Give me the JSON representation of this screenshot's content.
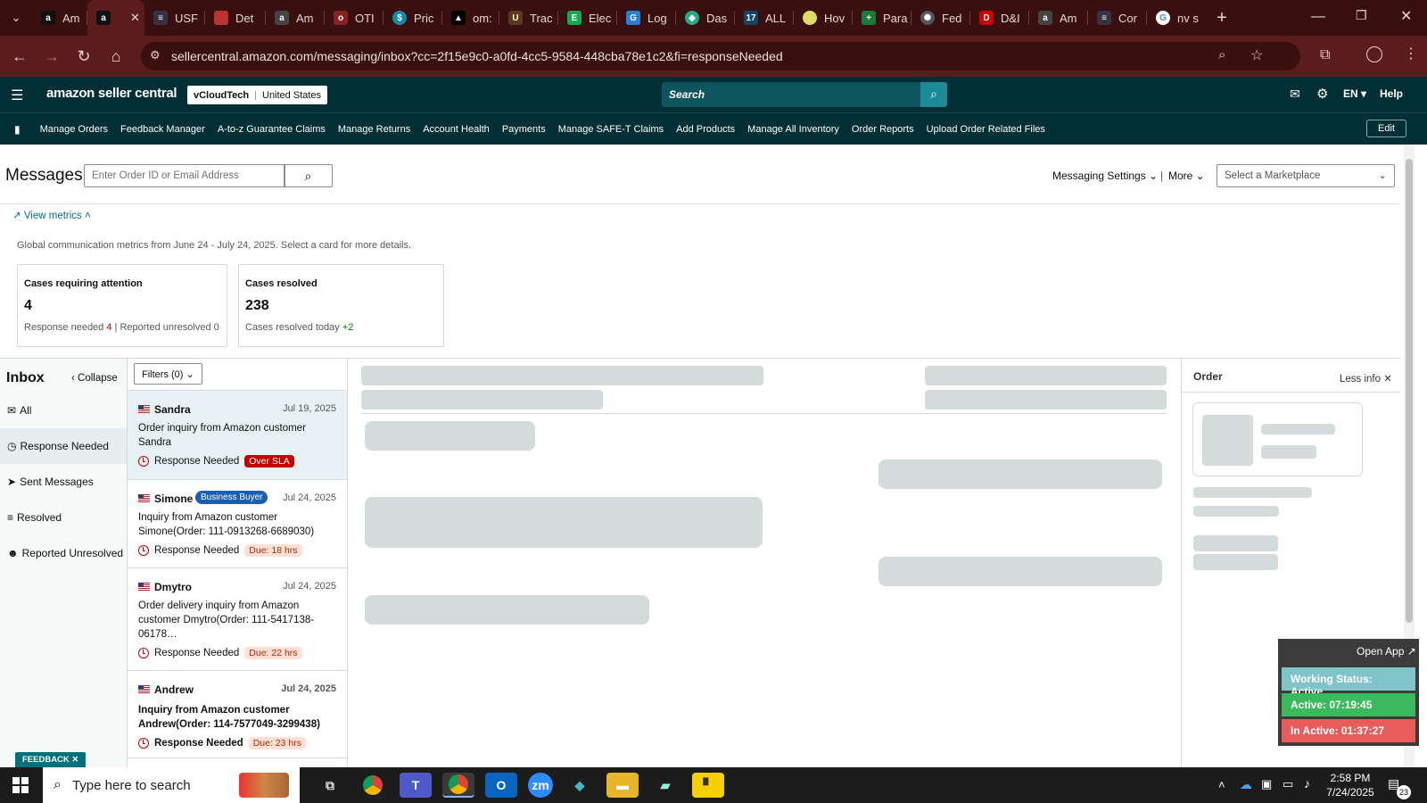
{
  "browser": {
    "tabs": [
      "Am",
      "",
      "USF",
      "Det",
      "Am",
      "OTI",
      "Pric",
      "om:",
      "Trac",
      "Elec",
      "Log",
      "Das",
      "ALL",
      "Hov",
      "Para",
      "Fed",
      "D&I",
      "Am",
      "Cor",
      "nv s"
    ],
    "url": "sellercentral.amazon.com/messaging/inbox?cc=2f15e9c0-a0fd-4cc5-9584-448cba78e1c2&fi=responseNeeded"
  },
  "header": {
    "logo": "amazon seller central",
    "account": "vCloudTech",
    "marketplace": "United States",
    "search_placeholder": "Search",
    "lang": "EN",
    "help": "Help"
  },
  "nav": {
    "links": [
      "Manage Orders",
      "Feedback Manager",
      "A-to-z Guarantee Claims",
      "Manage Returns",
      "Account Health",
      "Payments",
      "Manage SAFE-T Claims",
      "Add Products",
      "Manage All Inventory",
      "Order Reports",
      "Upload Order Related Files"
    ],
    "edit": "Edit"
  },
  "page": {
    "title": "Messages",
    "search_placeholder": "Enter Order ID or Email Address",
    "messaging_settings": "Messaging Settings",
    "more": "More",
    "marketplace_select": "Select a Marketplace",
    "view_metrics": "View metrics",
    "metrics_desc": "Global communication metrics from June 24 - July 24, 2025. Select a card for more details."
  },
  "metrics": {
    "attention_title": "Cases requiring attention",
    "attention_value": "4",
    "response_needed_label": "Response needed",
    "response_needed_value": "4",
    "reported_label": "Reported unresolved",
    "reported_value": "0",
    "resolved_title": "Cases resolved",
    "resolved_value": "238",
    "resolved_today_label": "Cases resolved today",
    "resolved_today_value": "+2"
  },
  "inbox": {
    "title": "Inbox",
    "collapse": "Collapse",
    "filters": "Filters (0)",
    "folders": [
      "All",
      "Response Needed",
      "Sent Messages",
      "Resolved",
      "Reported Unresolved"
    ]
  },
  "messages": [
    {
      "name": "Sandra",
      "date": "Jul 19, 2025",
      "body": "Order inquiry from Amazon customer Sandra",
      "status": "Response Needed",
      "badge": "Over SLA",
      "tag": ""
    },
    {
      "name": "Simone",
      "date": "Jul 24, 2025",
      "body": "Inquiry from Amazon customer Simone(Order: 111-0913268-6689030)",
      "status": "Response Needed",
      "badge": "Due: 18 hrs",
      "tag": "Business Buyer"
    },
    {
      "name": "Dmytro",
      "date": "Jul 24, 2025",
      "body": "Order delivery inquiry from Amazon customer Dmytro(Order: 111-5417138-06178…",
      "status": "Response Needed",
      "badge": "Due: 22 hrs",
      "tag": ""
    },
    {
      "name": "Andrew",
      "date": "Jul 24, 2025",
      "body": "Inquiry from Amazon customer Andrew(Order: 114-7577049-3299438)",
      "status": "Response Needed",
      "badge": "Due: 23 hrs",
      "tag": ""
    }
  ],
  "order_panel": {
    "title": "Order",
    "less_info": "Less info"
  },
  "widget": {
    "open_app": "Open App",
    "working": "Working Status: Active",
    "active": "Active: 07:19:45",
    "inactive": "In Active: 01:37:27"
  },
  "feedback": "FEEDBACK",
  "taskbar": {
    "search": "Type here to search",
    "time": "2:58 PM",
    "date": "7/24/2025",
    "notif": "23"
  }
}
